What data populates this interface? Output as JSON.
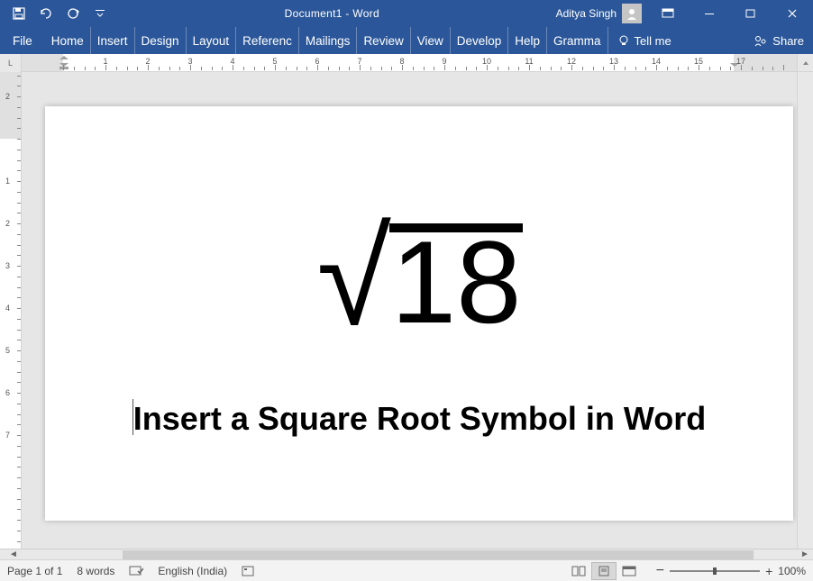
{
  "titlebar": {
    "doc_title": "Document1  -  Word",
    "user_name": "Aditya Singh"
  },
  "tabs": {
    "file": "File",
    "home": "Home",
    "insert": "Insert",
    "design": "Design",
    "layout": "Layout",
    "references": "Referenc",
    "mailings": "Mailings",
    "review": "Review",
    "view": "View",
    "developer": "Develop",
    "help": "Help",
    "grammarly": "Gramma",
    "tellme": "Tell me",
    "share": "Share"
  },
  "ruler": {
    "horizontal": [
      "1",
      "2",
      "3",
      "4",
      "5",
      "6",
      "7",
      "8",
      "9",
      "10",
      "11",
      "12",
      "13",
      "14",
      "15",
      "17"
    ],
    "vertical_top": [
      "2",
      "1"
    ],
    "vertical": [
      "1",
      "2",
      "3",
      "4",
      "5",
      "6",
      "7"
    ]
  },
  "document": {
    "radicand": "18",
    "caption": "Insert a Square Root Symbol in Word"
  },
  "statusbar": {
    "page": "Page 1 of 1",
    "words": "8 words",
    "language": "English (India)",
    "zoom": "100%"
  }
}
